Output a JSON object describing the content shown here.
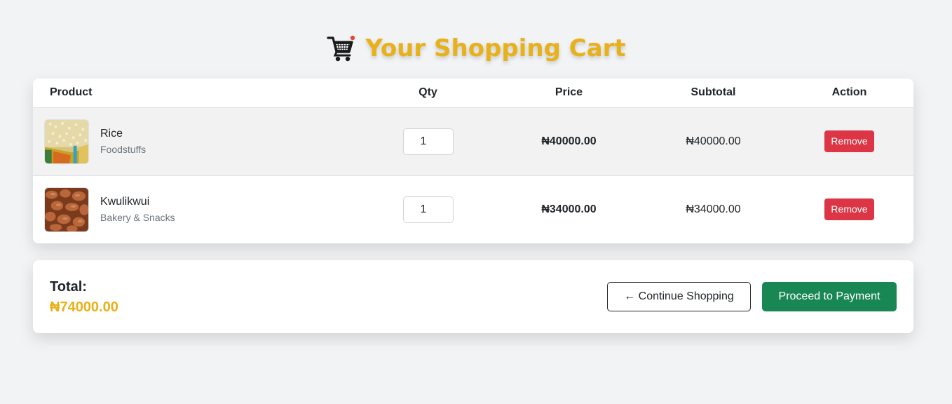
{
  "header": {
    "icon": "shopping-cart-icon",
    "title": "Your Shopping Cart",
    "accent_color": "#e8b11a"
  },
  "cart": {
    "columns": [
      "Product",
      "Qty",
      "Price",
      "Subtotal",
      "Action"
    ],
    "items": [
      {
        "name": "Rice",
        "category": "Foodstuffs",
        "qty": "1",
        "price": "₦40000.00",
        "subtotal": "₦40000.00",
        "action": "Remove"
      },
      {
        "name": "Kwulikwui",
        "category": "Bakery & Snacks",
        "qty": "1",
        "price": "₦34000.00",
        "subtotal": "₦34000.00",
        "action": "Remove"
      }
    ]
  },
  "summary": {
    "total_label": "Total:",
    "total_value": "₦74000.00",
    "continue_label": "← Continue Shopping",
    "pay_label": "Proceed to Payment"
  },
  "colors": {
    "remove": "#dc3545",
    "pay": "#198754",
    "background": "#f2f3f5"
  }
}
